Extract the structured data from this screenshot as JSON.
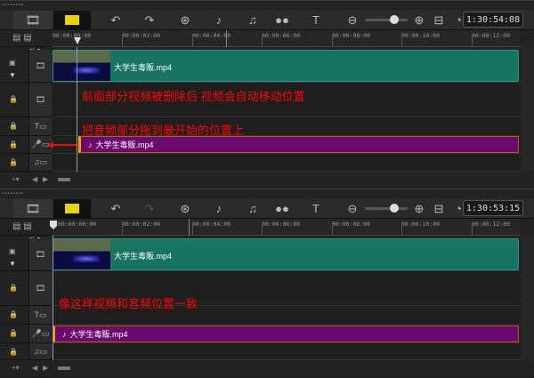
{
  "panels": [
    {
      "timecode": "1:30:54:08",
      "video_clip": "大学生毒贩.mp4",
      "audio_clip": "大学生毒贩.mp4",
      "annotations": [
        "前面部分视频被删除后 视频会自动移动位置",
        "把音频部分拖到最开始的位置上"
      ]
    },
    {
      "timecode": "1:30:53:15",
      "video_clip": "大学生毒贩.mp4",
      "audio_clip": "大学生毒贩.mp4",
      "annotations": [
        "像这样视频和音频位置一致"
      ]
    }
  ],
  "ruler": [
    "00:00:00:00",
    "00:00:02:00",
    "00:00:04:00",
    "00:00:06:00",
    "00:00:08:00",
    "00:00:10:00",
    "00:00:12:00"
  ],
  "add_remove": "+/- ▾",
  "colors": {
    "video_clip": "#177463",
    "audio_clip": "#6a0a6e",
    "annotation": "#ff0000"
  }
}
